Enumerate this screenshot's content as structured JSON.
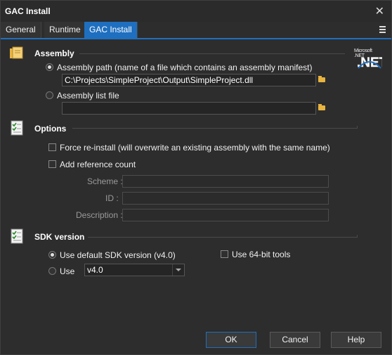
{
  "window": {
    "title": "GAC Install"
  },
  "tabs": [
    {
      "label": "General"
    },
    {
      "label": "Runtime"
    },
    {
      "label": "GAC Install"
    }
  ],
  "assembly": {
    "heading": "Assembly",
    "path_option": "Assembly path (name of a file which contains an assembly manifest)",
    "path_value": "C:\\Projects\\SimpleProject\\Output\\SimpleProject.dll",
    "list_option": "Assembly list file",
    "list_value": ""
  },
  "logo": {
    "text": "Microsoft .NET"
  },
  "options": {
    "heading": "Options",
    "force_reinstall": "Force re-install (will overwrite an existing assembly with the same name)",
    "add_reference": "Add reference count",
    "scheme_label": "Scheme :",
    "id_label": "ID :",
    "description_label": "Description :"
  },
  "sdk": {
    "heading": "SDK version",
    "default_option": "Use default SDK version (v4.0)",
    "use_option": "Use",
    "use_value": "v4.0",
    "use64": "Use 64-bit tools"
  },
  "buttons": {
    "ok": "OK",
    "cancel": "Cancel",
    "help": "Help"
  },
  "colors": {
    "accent": "#1e6fc0",
    "background": "#2d2d2d",
    "folder": "#e8b440"
  }
}
